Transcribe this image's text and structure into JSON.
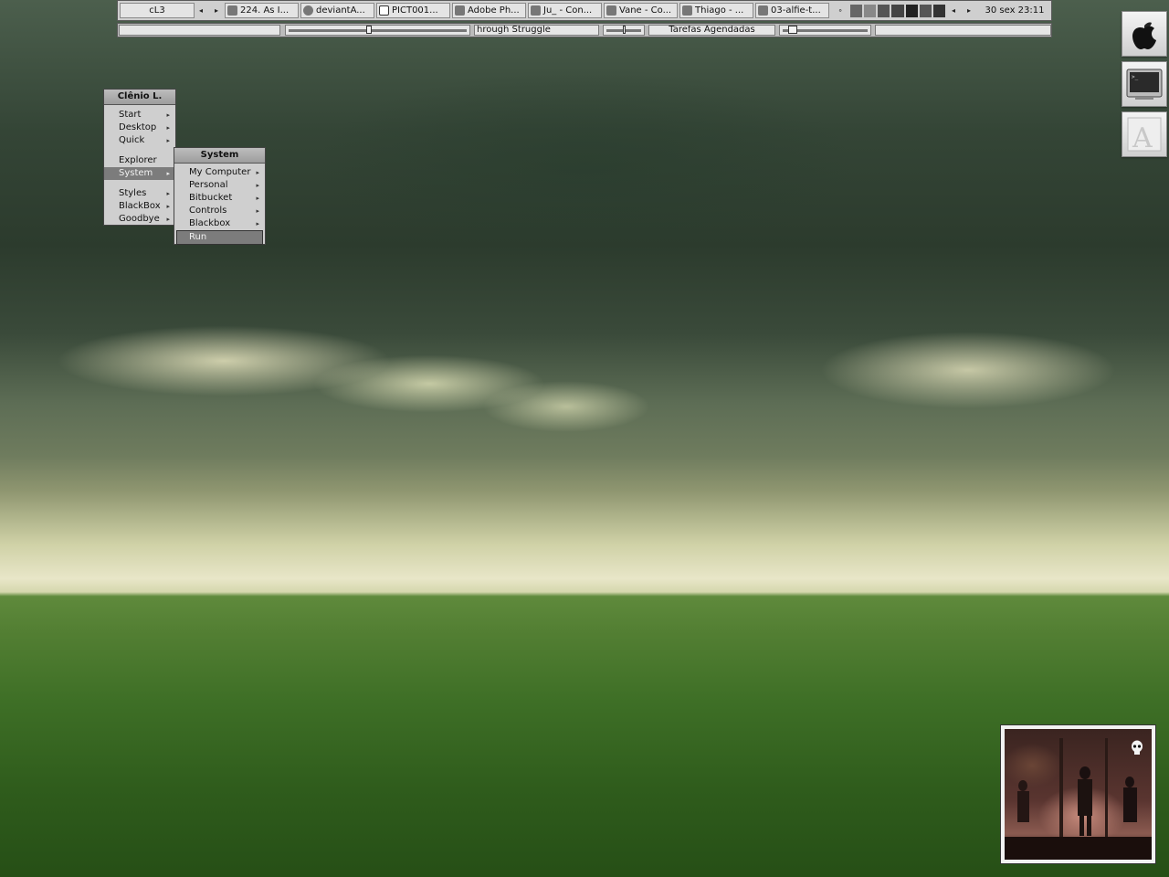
{
  "taskbar": {
    "workspace": "cL3",
    "tasks": [
      {
        "label": "224. As I...",
        "icon": "winamp-icon"
      },
      {
        "label": "deviantA...",
        "icon": "browser-icon"
      },
      {
        "label": "PICT001...",
        "icon": "image-window-icon"
      },
      {
        "label": "Adobe Ph...",
        "icon": "photoshop-icon"
      },
      {
        "label": "Ju_ - Con...",
        "icon": "chat-icon"
      },
      {
        "label": "Vane - Co...",
        "icon": "chat-icon"
      },
      {
        "label": "Thiago - ...",
        "icon": "chat-icon"
      },
      {
        "label": "03-alfie-t...",
        "icon": "media-file-icon"
      }
    ],
    "clock": "30 sex 23:11"
  },
  "systembar": {
    "track": "hrough Struggle",
    "scheduled": "Tarefas Agendadas",
    "volume_level": 0.45,
    "position_level": 0.1
  },
  "menu": {
    "title": "Clênio L.",
    "items": [
      "Start",
      "Desktop",
      "Quick",
      "Explorer",
      "System",
      "Styles",
      "BlackBox",
      "Goodbye"
    ]
  },
  "submenu": {
    "title": "System",
    "items": [
      "My Computer",
      "Personal",
      "Bitbucket",
      "Controls",
      "Blackbox",
      "Run"
    ]
  },
  "dock": [
    "apple-icon",
    "terminal-icon",
    "font-icon"
  ],
  "colors": {
    "menu_selected": "#7c7c7c",
    "bar": "#cfcfcf"
  }
}
